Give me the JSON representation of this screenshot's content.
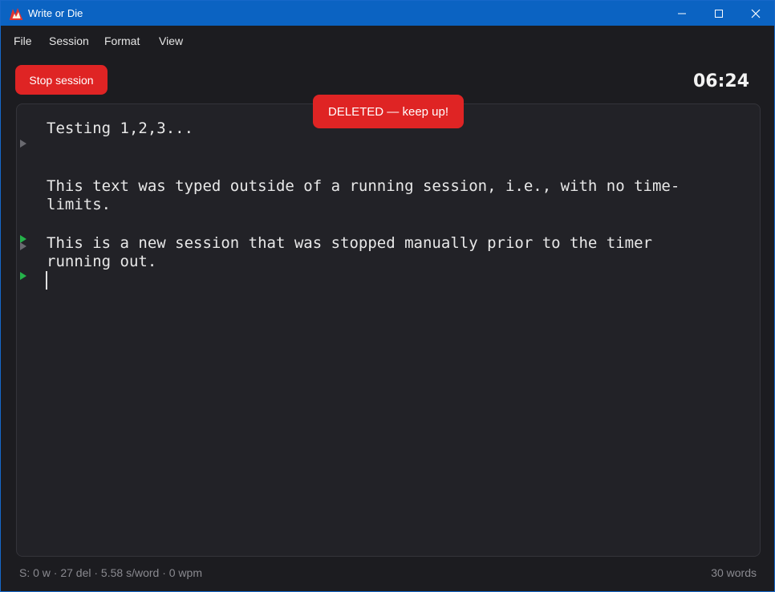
{
  "window": {
    "title": "Write or Die",
    "controls": {
      "minimize": "minimize-icon",
      "maximize": "maximize-icon",
      "close": "close-icon"
    }
  },
  "menu": [
    "File",
    "Session",
    "Format",
    "View"
  ],
  "toolbar": {
    "stop_label": "Stop session",
    "timer": "06:24"
  },
  "toast": "DELETED — keep up!",
  "editor": {
    "lines": [
      "Testing 1,2,3...",
      "This text was typed outside of a running session, i.e., with no time-",
      "limits.",
      "This is a new session that was stopped manually prior to the timer",
      "running out."
    ]
  },
  "status": {
    "stats": "S: 0 w · 27 del · 5.58 s/word · 0 wpm",
    "word_count": "30 words"
  },
  "colors": {
    "accent_red": "#df2424",
    "titlebar_blue": "#0b63c2",
    "marker_green": "#25b24a",
    "marker_gray": "#6a6a70"
  }
}
